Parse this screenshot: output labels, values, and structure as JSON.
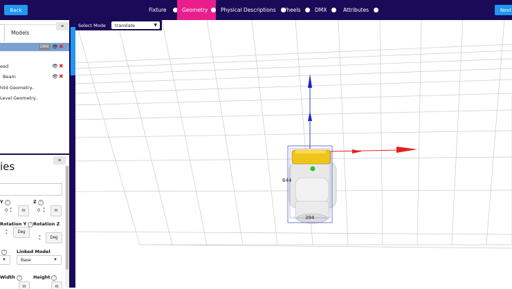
{
  "header": {
    "back_label": "Back",
    "next_label": "Next",
    "steps": [
      {
        "label": "Fixture",
        "active": false
      },
      {
        "label": "Geometry",
        "active": true
      },
      {
        "label": "Physical Descriptions",
        "active": false
      },
      {
        "label": "Wheels",
        "active": false
      },
      {
        "label": "DMX",
        "active": false
      },
      {
        "label": "Attributes",
        "active": false
      }
    ]
  },
  "models_panel": {
    "tab_label": "Models",
    "menu_icon": "≡",
    "rows": [
      {
        "label": "",
        "badge": "DMX",
        "selected": true
      },
      {
        "label": "ead",
        "selected": false
      },
      {
        "label": "Beam",
        "selected": false
      },
      {
        "label": "hild Geometry..",
        "selected": false
      },
      {
        "label": "Level Geometry..",
        "selected": false
      }
    ]
  },
  "properties_panel": {
    "title": "ies",
    "menu_icon": "≡",
    "y_label": "Y",
    "z_label": "Z",
    "y_value": "0",
    "z_value": "0",
    "unit_m": "m",
    "rot_y_label": "Rotation Y",
    "rot_z_label": "Rotation Z",
    "unit_deg": "Deg",
    "linked_model_label": "Linked Model",
    "linked_model_value": "Base",
    "width_label": "Width",
    "height_label": "Height"
  },
  "viewport": {
    "select_mode_label": "Select Mode",
    "select_mode_value": "translate",
    "dim_label_a": "644",
    "dim_label_b": "394"
  },
  "colors": {
    "nav_bg": "#1a0a57",
    "active_step": "#e91e8c",
    "button_blue": "#2196f3",
    "selected_row": "#7ca0d0",
    "axis_x": "#e81e1e",
    "axis_y": "#1e1ed8",
    "fixture_yellow": "#f0c419"
  }
}
